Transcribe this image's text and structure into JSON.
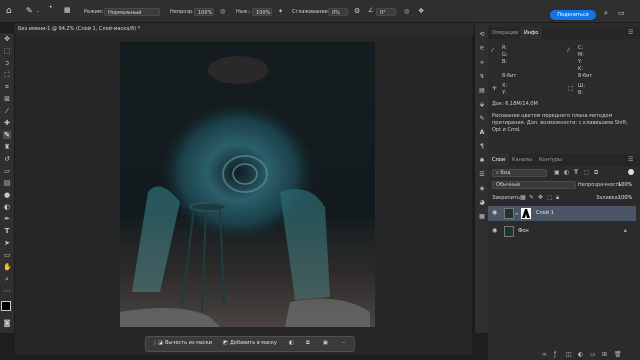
{
  "options_bar": {
    "mode_label": "Режим:",
    "mode_value": "Нормальный",
    "opacity_label": "Непрозр.:",
    "opacity_value": "100%",
    "pressure_label": "Наж.:",
    "pressure_value": "100%",
    "smoothing_label": "Сглаживание:",
    "smoothing_value": "0%",
    "angle_value": "0°",
    "share_label": "Поделиться"
  },
  "document": {
    "tab_title": "Без имени-1 @ 94,2% (Слой 1, Слой-маска/8) *"
  },
  "context_bar": {
    "subtract_label": "Вычесть из маски",
    "add_label": "Добавить в маску"
  },
  "info_panel": {
    "tabs": [
      "Операции",
      "Инфо"
    ],
    "active_tab": "Инфо",
    "r_label": "R:",
    "g_label": "G:",
    "b_label": "B:",
    "c_label": "C:",
    "m_label": "M:",
    "y_label": "Y:",
    "k_label": "K:",
    "bit_left": "8-бит",
    "bit_right": "8-бит",
    "x_label": "X:",
    "y2_label": "Y:",
    "w_label": "Ш:",
    "h_label": "В:",
    "doc_size": "Док: 6,18M/14,0M",
    "hint": "Рисование цветом переднего плана методом притирания. Доп. возможности: с клавишами Shift, Opt и Cmd."
  },
  "layers_panel": {
    "tabs": [
      "Слои",
      "Каналы",
      "Контуры"
    ],
    "active_tab": "Слои",
    "filter_label": "Вид",
    "blend_mode": "Обычные",
    "opacity_label": "Непрозрачность:",
    "opacity_value": "100%",
    "lock_label": "Закрепить:",
    "fill_label": "Заливка:",
    "fill_value": "100%",
    "layers": [
      {
        "name": "Слой 1",
        "selected": true
      },
      {
        "name": "Фон",
        "selected": false
      }
    ]
  }
}
